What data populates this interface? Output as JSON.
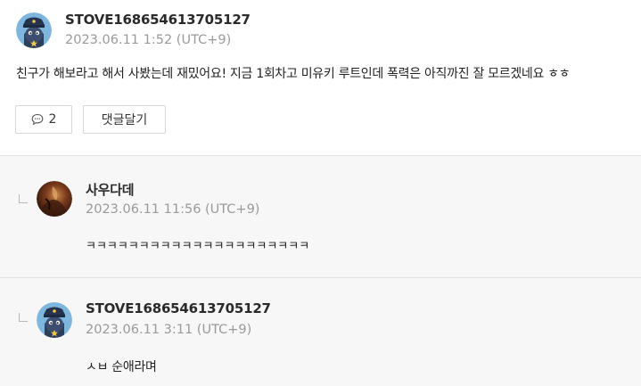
{
  "comment": {
    "author": "STOVE168654613705127",
    "date": "2023.06.11 1:52 (UTC+9)",
    "text": "친구가 해보라고 해서 사봤는데 재밌어요! 지금 1회차고 미유키 루트인데 폭력은 아직까진 잘 모르겠네요 ㅎㅎ",
    "reply_count": "2",
    "reply_button_label": "댓글달기",
    "avatar_icon": "police-bird-avatar"
  },
  "replies": [
    {
      "author": "사우다데",
      "date": "2023.06.11 11:56 (UTC+9)",
      "text": "ㅋㅋㅋㅋㅋㅋㅋㅋㅋㅋㅋㅋㅋㅋㅋㅋㅋㅋㅋㅋㅋ",
      "avatar_icon": "artwork-avatar"
    },
    {
      "author": "STOVE168654613705127",
      "date": "2023.06.11 3:11 (UTC+9)",
      "text": "ㅅㅂ 순애라며",
      "avatar_icon": "police-bird-avatar"
    }
  ],
  "colors": {
    "reply_background": "#f7f7f7",
    "border": "#e2e2e2",
    "date_text": "#9a9a9a",
    "avatar_bg": "#7eb6dd"
  }
}
